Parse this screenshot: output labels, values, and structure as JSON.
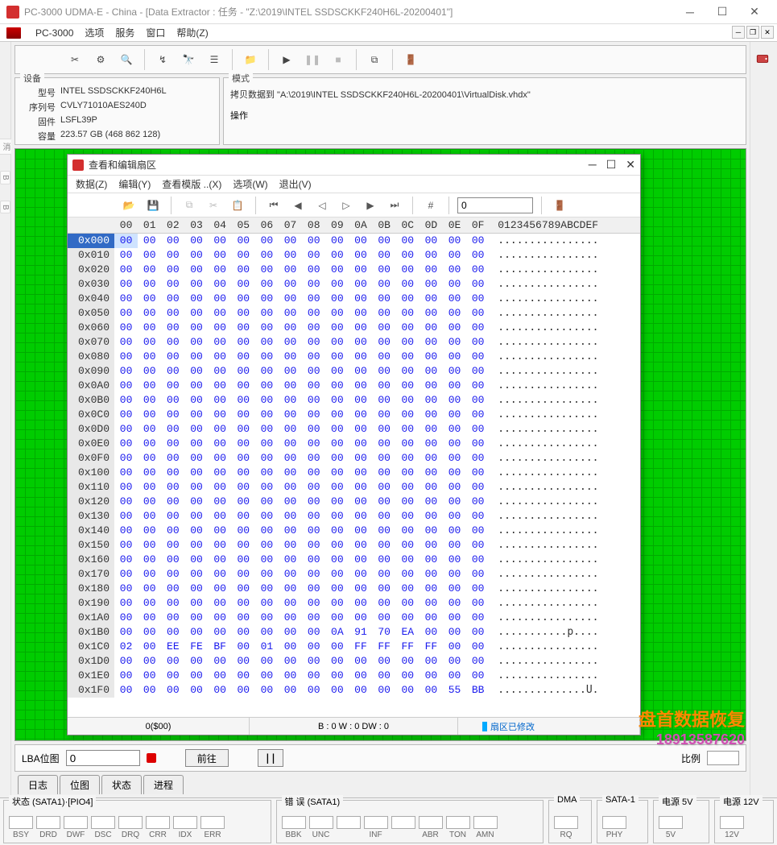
{
  "window": {
    "title": "PC-3000 UDMA-E - China - [Data Extractor : 任务 - \"Z:\\2019\\INTEL SSDSCKKF240H6L-20200401\"]"
  },
  "menubar": {
    "app": "PC-3000",
    "items": [
      "选项",
      "服务",
      "窗口",
      "帮助(Z)"
    ]
  },
  "device_panel": {
    "legend": "设备",
    "model_label": "型号",
    "model": "INTEL SSDSCKKF240H6L",
    "serial_label": "序列号",
    "serial": "CVLY71010AES240D",
    "firmware_label": "固件",
    "firmware": "LSFL39P",
    "capacity_label": "容量",
    "capacity": "223.57 GB (468 862 128)"
  },
  "mode_panel": {
    "legend": "模式",
    "text": "拷贝数据到 \"A:\\2019\\INTEL SSDSCKKF240H6L-20200401\\VirtualDisk.vhdx\"",
    "op_legend": "操作"
  },
  "hex_window": {
    "title": "查看和编辑扇区",
    "menus": {
      "data": "数据(Z)",
      "edit": "编辑(Y)",
      "template": "查看模版 ..(X)",
      "options": "选项(W)",
      "exit": "退出(V)"
    },
    "offset_input": "0",
    "header_cols": [
      "00",
      "01",
      "02",
      "03",
      "04",
      "05",
      "06",
      "07",
      "08",
      "09",
      "0A",
      "0B",
      "0C",
      "0D",
      "0E",
      "0F"
    ],
    "ascii_header": "0123456789ABCDEF",
    "rows": [
      {
        "off": "0x000",
        "b": [
          "00",
          "00",
          "00",
          "00",
          "00",
          "00",
          "00",
          "00",
          "00",
          "00",
          "00",
          "00",
          "00",
          "00",
          "00",
          "00"
        ],
        "a": "................",
        "sel": true
      },
      {
        "off": "0x010",
        "b": [
          "00",
          "00",
          "00",
          "00",
          "00",
          "00",
          "00",
          "00",
          "00",
          "00",
          "00",
          "00",
          "00",
          "00",
          "00",
          "00"
        ],
        "a": "................"
      },
      {
        "off": "0x020",
        "b": [
          "00",
          "00",
          "00",
          "00",
          "00",
          "00",
          "00",
          "00",
          "00",
          "00",
          "00",
          "00",
          "00",
          "00",
          "00",
          "00"
        ],
        "a": "................"
      },
      {
        "off": "0x030",
        "b": [
          "00",
          "00",
          "00",
          "00",
          "00",
          "00",
          "00",
          "00",
          "00",
          "00",
          "00",
          "00",
          "00",
          "00",
          "00",
          "00"
        ],
        "a": "................"
      },
      {
        "off": "0x040",
        "b": [
          "00",
          "00",
          "00",
          "00",
          "00",
          "00",
          "00",
          "00",
          "00",
          "00",
          "00",
          "00",
          "00",
          "00",
          "00",
          "00"
        ],
        "a": "................"
      },
      {
        "off": "0x050",
        "b": [
          "00",
          "00",
          "00",
          "00",
          "00",
          "00",
          "00",
          "00",
          "00",
          "00",
          "00",
          "00",
          "00",
          "00",
          "00",
          "00"
        ],
        "a": "................"
      },
      {
        "off": "0x060",
        "b": [
          "00",
          "00",
          "00",
          "00",
          "00",
          "00",
          "00",
          "00",
          "00",
          "00",
          "00",
          "00",
          "00",
          "00",
          "00",
          "00"
        ],
        "a": "................"
      },
      {
        "off": "0x070",
        "b": [
          "00",
          "00",
          "00",
          "00",
          "00",
          "00",
          "00",
          "00",
          "00",
          "00",
          "00",
          "00",
          "00",
          "00",
          "00",
          "00"
        ],
        "a": "................"
      },
      {
        "off": "0x080",
        "b": [
          "00",
          "00",
          "00",
          "00",
          "00",
          "00",
          "00",
          "00",
          "00",
          "00",
          "00",
          "00",
          "00",
          "00",
          "00",
          "00"
        ],
        "a": "................"
      },
      {
        "off": "0x090",
        "b": [
          "00",
          "00",
          "00",
          "00",
          "00",
          "00",
          "00",
          "00",
          "00",
          "00",
          "00",
          "00",
          "00",
          "00",
          "00",
          "00"
        ],
        "a": "................"
      },
      {
        "off": "0x0A0",
        "b": [
          "00",
          "00",
          "00",
          "00",
          "00",
          "00",
          "00",
          "00",
          "00",
          "00",
          "00",
          "00",
          "00",
          "00",
          "00",
          "00"
        ],
        "a": "................"
      },
      {
        "off": "0x0B0",
        "b": [
          "00",
          "00",
          "00",
          "00",
          "00",
          "00",
          "00",
          "00",
          "00",
          "00",
          "00",
          "00",
          "00",
          "00",
          "00",
          "00"
        ],
        "a": "................"
      },
      {
        "off": "0x0C0",
        "b": [
          "00",
          "00",
          "00",
          "00",
          "00",
          "00",
          "00",
          "00",
          "00",
          "00",
          "00",
          "00",
          "00",
          "00",
          "00",
          "00"
        ],
        "a": "................"
      },
      {
        "off": "0x0D0",
        "b": [
          "00",
          "00",
          "00",
          "00",
          "00",
          "00",
          "00",
          "00",
          "00",
          "00",
          "00",
          "00",
          "00",
          "00",
          "00",
          "00"
        ],
        "a": "................"
      },
      {
        "off": "0x0E0",
        "b": [
          "00",
          "00",
          "00",
          "00",
          "00",
          "00",
          "00",
          "00",
          "00",
          "00",
          "00",
          "00",
          "00",
          "00",
          "00",
          "00"
        ],
        "a": "................"
      },
      {
        "off": "0x0F0",
        "b": [
          "00",
          "00",
          "00",
          "00",
          "00",
          "00",
          "00",
          "00",
          "00",
          "00",
          "00",
          "00",
          "00",
          "00",
          "00",
          "00"
        ],
        "a": "................"
      },
      {
        "off": "0x100",
        "b": [
          "00",
          "00",
          "00",
          "00",
          "00",
          "00",
          "00",
          "00",
          "00",
          "00",
          "00",
          "00",
          "00",
          "00",
          "00",
          "00"
        ],
        "a": "................"
      },
      {
        "off": "0x110",
        "b": [
          "00",
          "00",
          "00",
          "00",
          "00",
          "00",
          "00",
          "00",
          "00",
          "00",
          "00",
          "00",
          "00",
          "00",
          "00",
          "00"
        ],
        "a": "................"
      },
      {
        "off": "0x120",
        "b": [
          "00",
          "00",
          "00",
          "00",
          "00",
          "00",
          "00",
          "00",
          "00",
          "00",
          "00",
          "00",
          "00",
          "00",
          "00",
          "00"
        ],
        "a": "................"
      },
      {
        "off": "0x130",
        "b": [
          "00",
          "00",
          "00",
          "00",
          "00",
          "00",
          "00",
          "00",
          "00",
          "00",
          "00",
          "00",
          "00",
          "00",
          "00",
          "00"
        ],
        "a": "................"
      },
      {
        "off": "0x140",
        "b": [
          "00",
          "00",
          "00",
          "00",
          "00",
          "00",
          "00",
          "00",
          "00",
          "00",
          "00",
          "00",
          "00",
          "00",
          "00",
          "00"
        ],
        "a": "................"
      },
      {
        "off": "0x150",
        "b": [
          "00",
          "00",
          "00",
          "00",
          "00",
          "00",
          "00",
          "00",
          "00",
          "00",
          "00",
          "00",
          "00",
          "00",
          "00",
          "00"
        ],
        "a": "................"
      },
      {
        "off": "0x160",
        "b": [
          "00",
          "00",
          "00",
          "00",
          "00",
          "00",
          "00",
          "00",
          "00",
          "00",
          "00",
          "00",
          "00",
          "00",
          "00",
          "00"
        ],
        "a": "................"
      },
      {
        "off": "0x170",
        "b": [
          "00",
          "00",
          "00",
          "00",
          "00",
          "00",
          "00",
          "00",
          "00",
          "00",
          "00",
          "00",
          "00",
          "00",
          "00",
          "00"
        ],
        "a": "................"
      },
      {
        "off": "0x180",
        "b": [
          "00",
          "00",
          "00",
          "00",
          "00",
          "00",
          "00",
          "00",
          "00",
          "00",
          "00",
          "00",
          "00",
          "00",
          "00",
          "00"
        ],
        "a": "................"
      },
      {
        "off": "0x190",
        "b": [
          "00",
          "00",
          "00",
          "00",
          "00",
          "00",
          "00",
          "00",
          "00",
          "00",
          "00",
          "00",
          "00",
          "00",
          "00",
          "00"
        ],
        "a": "................"
      },
      {
        "off": "0x1A0",
        "b": [
          "00",
          "00",
          "00",
          "00",
          "00",
          "00",
          "00",
          "00",
          "00",
          "00",
          "00",
          "00",
          "00",
          "00",
          "00",
          "00"
        ],
        "a": "................"
      },
      {
        "off": "0x1B0",
        "b": [
          "00",
          "00",
          "00",
          "00",
          "00",
          "00",
          "00",
          "00",
          "00",
          "0A",
          "91",
          "70",
          "EA",
          "00",
          "00",
          "00"
        ],
        "a": "...........p...."
      },
      {
        "off": "0x1C0",
        "b": [
          "02",
          "00",
          "EE",
          "FE",
          "BF",
          "00",
          "01",
          "00",
          "00",
          "00",
          "FF",
          "FF",
          "FF",
          "FF",
          "00",
          "00"
        ],
        "a": "................"
      },
      {
        "off": "0x1D0",
        "b": [
          "00",
          "00",
          "00",
          "00",
          "00",
          "00",
          "00",
          "00",
          "00",
          "00",
          "00",
          "00",
          "00",
          "00",
          "00",
          "00"
        ],
        "a": "................"
      },
      {
        "off": "0x1E0",
        "b": [
          "00",
          "00",
          "00",
          "00",
          "00",
          "00",
          "00",
          "00",
          "00",
          "00",
          "00",
          "00",
          "00",
          "00",
          "00",
          "00"
        ],
        "a": "................"
      },
      {
        "off": "0x1F0",
        "b": [
          "00",
          "00",
          "00",
          "00",
          "00",
          "00",
          "00",
          "00",
          "00",
          "00",
          "00",
          "00",
          "00",
          "00",
          "55",
          "BB"
        ],
        "a": "..............U."
      }
    ],
    "status": {
      "offset": "0($00)",
      "bwdw": "B : 0 W : 0 DW : 0",
      "modified": "扇区已修改"
    }
  },
  "lba_row": {
    "label": "LBA位图",
    "value": "0",
    "go_button": "前往",
    "pause": "||",
    "scale_label": "比例"
  },
  "tabs": [
    "日志",
    "位图",
    "状态",
    "进程"
  ],
  "bottom": {
    "sata_state": {
      "legend": "状态 (SATA1)·[PIO4]",
      "cells": [
        "BSY",
        "DRD",
        "DWF",
        "DSC",
        "DRQ",
        "CRR",
        "IDX",
        "ERR"
      ]
    },
    "sata_err": {
      "legend": "错 误 (SATA1)",
      "cells": [
        "BBK",
        "UNC",
        "",
        "INF",
        "",
        "ABR",
        "TON",
        "AMN"
      ]
    },
    "dma": {
      "legend": "DMA",
      "cells": [
        "RQ"
      ]
    },
    "sata1": {
      "legend": "SATA-1",
      "cells": [
        "PHY"
      ]
    },
    "pwr5": {
      "legend": "电源 5V",
      "cells": [
        "5V"
      ]
    },
    "pwr12": {
      "legend": "电源 12V",
      "cells": [
        "12V"
      ]
    }
  },
  "watermark": {
    "line1": "盘首数据恢复",
    "line2": "18913587620"
  }
}
